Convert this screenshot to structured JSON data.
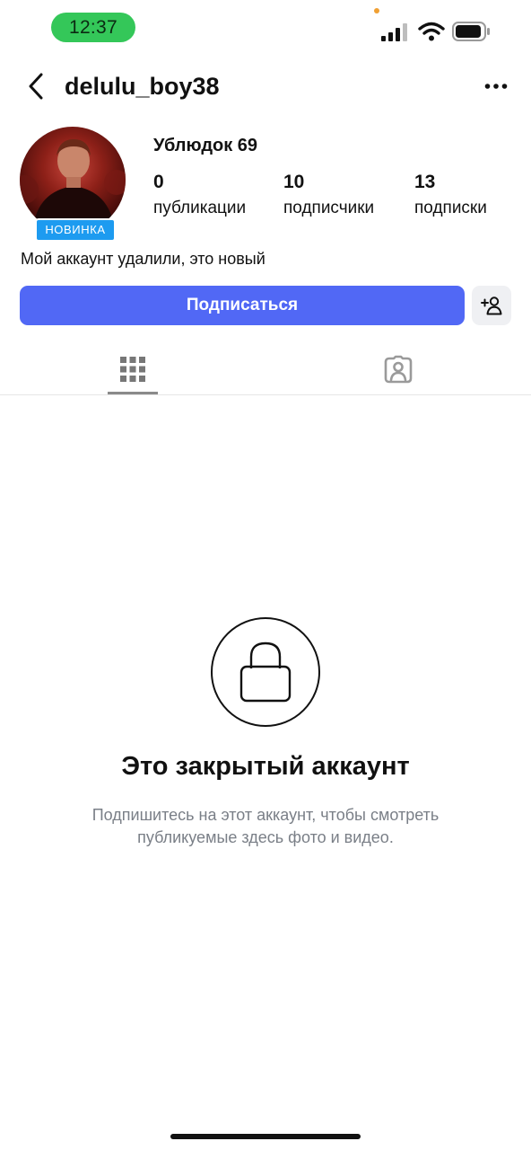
{
  "status_bar": {
    "time": "12:37"
  },
  "header": {
    "username": "delulu_boy38"
  },
  "profile": {
    "badge": "НОВИНКА",
    "display_name": "Ублюдок 69",
    "stats": [
      {
        "value": "0",
        "label": "публикации"
      },
      {
        "value": "10",
        "label": "подписчики"
      },
      {
        "value": "13",
        "label": "подписки"
      }
    ],
    "bio": "Мой аккаунт удалили, это новый"
  },
  "actions": {
    "follow_label": "Подписаться"
  },
  "tabs": [
    {
      "icon": "grid-icon",
      "selected": true
    },
    {
      "icon": "tagged-icon",
      "selected": false
    }
  ],
  "private_notice": {
    "title": "Это закрытый аккаунт",
    "subtitle_line1": "Подпишитесь на этот аккаунт, чтобы смотреть",
    "subtitle_line2": "публикуемые здесь фото и видео."
  },
  "colors": {
    "accent": "#5168f5",
    "badge": "#1d9bf0",
    "status_pill": "#34c759"
  }
}
